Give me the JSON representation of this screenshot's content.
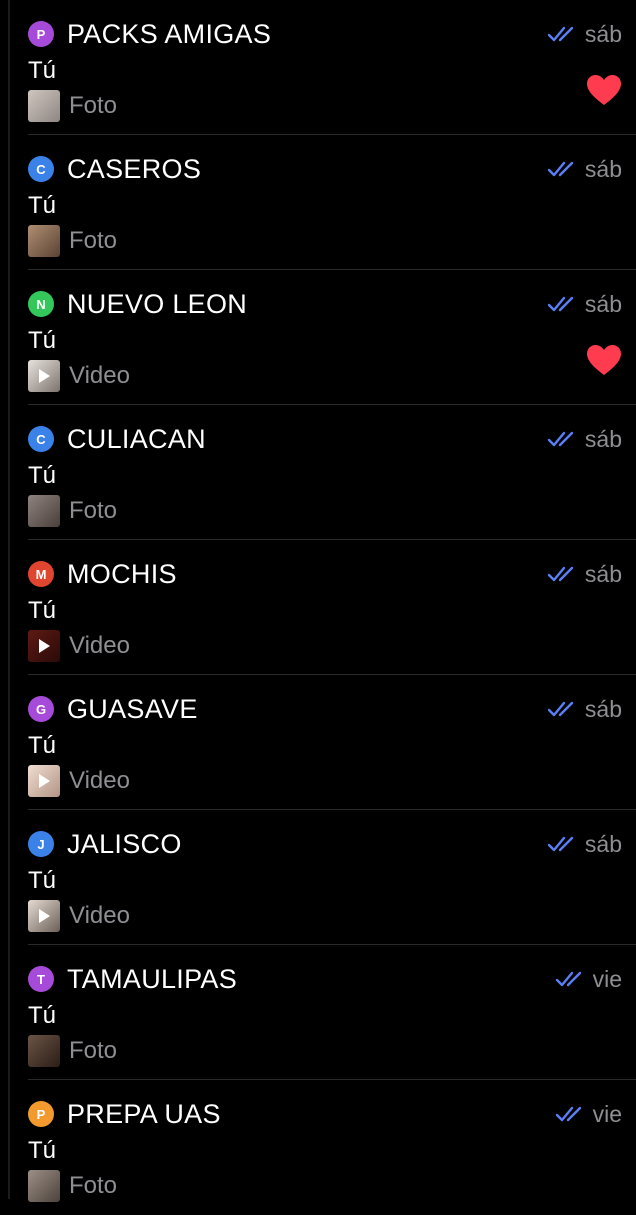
{
  "chats": [
    {
      "name": "PACKS AMIGAS",
      "initial": "P",
      "avatar_color": "#a64bd9",
      "date": "sáb",
      "sender": "Tú",
      "media": "Foto",
      "thumb_bg": "linear-gradient(135deg,#cfc6bf,#8e8683)",
      "video": false,
      "reaction": true
    },
    {
      "name": "CASEROS",
      "initial": "C",
      "avatar_color": "#3b82e8",
      "date": "sáb",
      "sender": "Tú",
      "media": "Foto",
      "thumb_bg": "linear-gradient(135deg,#b08f73,#5a4233)",
      "video": false,
      "reaction": false
    },
    {
      "name": "NUEVO LEON",
      "initial": "N",
      "avatar_color": "#34c759",
      "date": "sáb",
      "sender": "Tú",
      "media": "Video",
      "thumb_bg": "linear-gradient(135deg,#e8e3df,#7d736d)",
      "video": true,
      "reaction": true
    },
    {
      "name": "CULIACAN",
      "initial": "C",
      "avatar_color": "#3b82e8",
      "date": "sáb",
      "sender": "Tú",
      "media": "Foto",
      "thumb_bg": "linear-gradient(135deg,#8f8380,#4a3e3b)",
      "video": false,
      "reaction": false
    },
    {
      "name": "MOCHIS",
      "initial": "M",
      "avatar_color": "#e0452f",
      "date": "sáb",
      "sender": "Tú",
      "media": "Video",
      "thumb_bg": "linear-gradient(135deg,#5e1a14,#2a0a08)",
      "video": true,
      "reaction": false
    },
    {
      "name": "GUASAVE",
      "initial": "G",
      "avatar_color": "#a64bd9",
      "date": "sáb",
      "sender": "Tú",
      "media": "Video",
      "thumb_bg": "linear-gradient(135deg,#f0ddd2,#b29484)",
      "video": true,
      "reaction": false
    },
    {
      "name": "JALISCO",
      "initial": "J",
      "avatar_color": "#3b82e8",
      "date": "sáb",
      "sender": "Tú",
      "media": "Video",
      "thumb_bg": "linear-gradient(135deg,#e6dcd4,#6b5f57)",
      "video": true,
      "reaction": false
    },
    {
      "name": "TAMAULIPAS",
      "initial": "T",
      "avatar_color": "#a64bd9",
      "date": "vie",
      "sender": "Tú",
      "media": "Foto",
      "thumb_bg": "linear-gradient(135deg,#6b5446,#2b1d16)",
      "video": false,
      "reaction": false
    },
    {
      "name": "PREPA UAS",
      "initial": "P",
      "avatar_color": "#f29a2e",
      "date": "vie",
      "sender": "Tú",
      "media": "Foto",
      "thumb_bg": "linear-gradient(135deg,#9c8f86,#4d433c)",
      "video": false,
      "reaction": false
    }
  ],
  "check_color": "#5b7ff5",
  "reaction_color": "#ff3b4f",
  "icons": {
    "read": "double-check-icon",
    "reaction": "heart-icon",
    "play": "play-icon"
  }
}
